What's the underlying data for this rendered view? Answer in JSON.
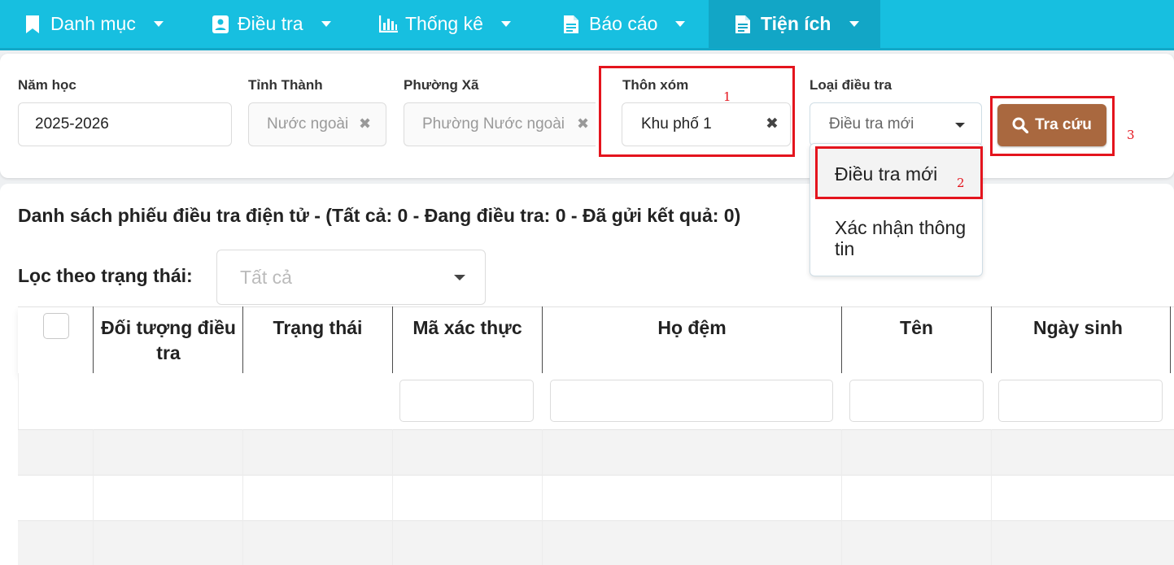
{
  "nav": {
    "items": [
      {
        "label": "Danh mục",
        "icon": "bookmark-icon"
      },
      {
        "label": "Điều tra",
        "icon": "contact-card-icon"
      },
      {
        "label": "Thống kê",
        "icon": "bar-chart-icon"
      },
      {
        "label": "Báo cáo",
        "icon": "document-icon"
      },
      {
        "label": "Tiện ích",
        "icon": "document-icon",
        "active": true
      }
    ]
  },
  "filters": {
    "nam_hoc": {
      "label": "Năm học",
      "value": "2025-2026"
    },
    "tinh_thanh": {
      "label": "Tỉnh Thành",
      "value": "Nước ngoài"
    },
    "phuong_xa": {
      "label": "Phường Xã",
      "value": "Phường Nước ngoài"
    },
    "thon_xom": {
      "label": "Thôn xóm",
      "value": "Khu phố 1"
    },
    "loai_dieu_tra": {
      "label": "Loại điều tra",
      "value": "Điều tra mới",
      "options": [
        "Điều tra mới",
        "Xác nhận thông tin"
      ]
    },
    "search_label": "Tra cứu",
    "clear_glyph": "✖"
  },
  "annotations": [
    "1",
    "2",
    "3"
  ],
  "list": {
    "title": "Danh sách phiếu điều tra điện tử - (Tất cả: 0 - Đang điều tra: 0 - Đã gửi kết quả: 0)",
    "filter_label": "Lọc theo trạng thái:",
    "filter_value": "Tất cả"
  },
  "table": {
    "columns": [
      "Đối tượng điều tra",
      "Trạng thái",
      "Mã xác thực",
      "Họ đệm",
      "Tên",
      "Ngày sinh"
    ]
  },
  "colors": {
    "nav_bg": "#17bfe0",
    "nav_active": "#12a6c6",
    "button": "#a9683f",
    "highlight": "#e4141d"
  }
}
